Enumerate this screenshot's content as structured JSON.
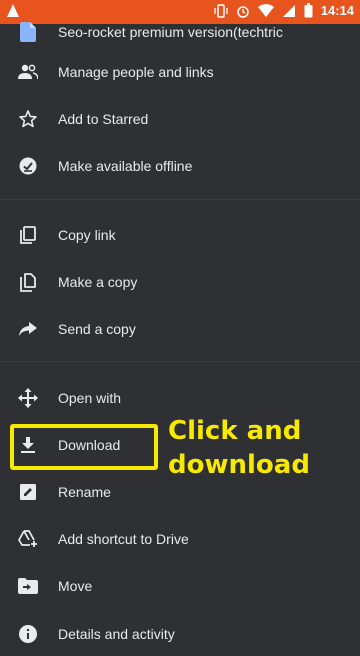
{
  "status_bar": {
    "time": "14:14",
    "icons": [
      "notification-icon",
      "vibrate-icon",
      "alarm-icon",
      "wifi-icon",
      "signal-icon",
      "battery-icon"
    ]
  },
  "menu": {
    "items": [
      {
        "label": "Seo-rocket premium version(techtric",
        "icon": "document-icon"
      },
      {
        "label": "Manage people and links",
        "icon": "people-icon"
      },
      {
        "label": "Add to Starred",
        "icon": "star-icon"
      },
      {
        "label": "Make available offline",
        "icon": "offline-icon"
      },
      {
        "label": "Copy link",
        "icon": "copy-link-icon"
      },
      {
        "label": "Make a copy",
        "icon": "copy-icon"
      },
      {
        "label": "Send a copy",
        "icon": "share-icon"
      },
      {
        "label": "Open with",
        "icon": "open-with-icon"
      },
      {
        "label": "Download",
        "icon": "download-icon"
      },
      {
        "label": "Rename",
        "icon": "rename-icon"
      },
      {
        "label": "Add shortcut to Drive",
        "icon": "add-shortcut-icon"
      },
      {
        "label": "Move",
        "icon": "move-icon"
      },
      {
        "label": "Details and activity",
        "icon": "info-icon"
      }
    ]
  },
  "annotation": {
    "line1": "Click and",
    "line2": "download",
    "color": "#f7ea00"
  },
  "colors": {
    "status_bar": "#e8541e",
    "background": "#2f3033",
    "doc_icon": "#8ab4f8"
  }
}
